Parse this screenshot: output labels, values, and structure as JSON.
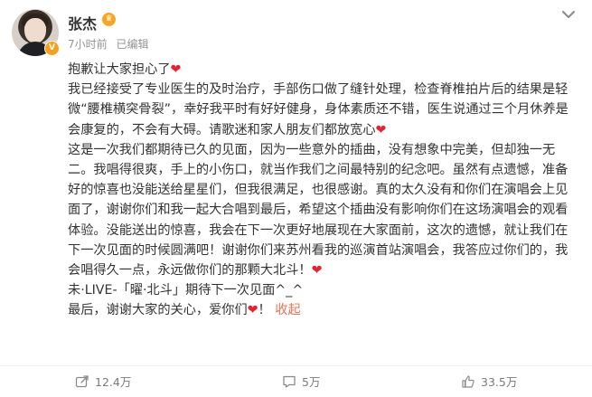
{
  "post": {
    "author": "张杰",
    "time": "7小时前",
    "edited": "已编辑",
    "paragraphs": [
      "抱歉让大家担心了",
      "我已经接受了专业医生的及时治疗，手部伤口做了缝针处理，检查脊椎拍片后的结果是轻微“腰椎横突骨裂”，幸好我平时有好好健身，身体素质还不错，医生说通过三个月休养是会康复的，不会有大碍。请歌迷和家人朋友们都放宽心",
      "这是一次我们都期待已久的见面，因为一些意外的插曲，没有想象中完美，但却独一无二。我唱得很爽，手上的小伤口，就当作我们之间最特别的纪念吧。虽然有点遗憾，准备好的惊喜也没能送给星星们，但我很满足，也很感谢。真的太久没有和你们在演唱会上见面了，谢谢你们和我一起大合唱到最后，希望这个插曲没有影响你们在这场演唱会的观看体验。没能送出的惊喜，我会在下一次更好地展现在大家面前，这次的遗憾，就让我们在下一次见面的时候圆满吧！谢谢你们来苏州看我的巡演首站演唱会，我答应过你们的，我会唱得久一点，永远做你们的那颗大北斗！",
      "未·LIVE-「曜·北斗」期待下一次见面^_^",
      "最后，谢谢大家的关心，爱你们",
      "！"
    ],
    "heart": "❤",
    "collapse_label": "收起"
  },
  "actions": {
    "share_count": "12.4万",
    "comment_count": "5万",
    "like_count": "33.5万"
  },
  "colors": {
    "accent": "#eb7350",
    "heart": "#e8202f",
    "muted": "#939393"
  }
}
